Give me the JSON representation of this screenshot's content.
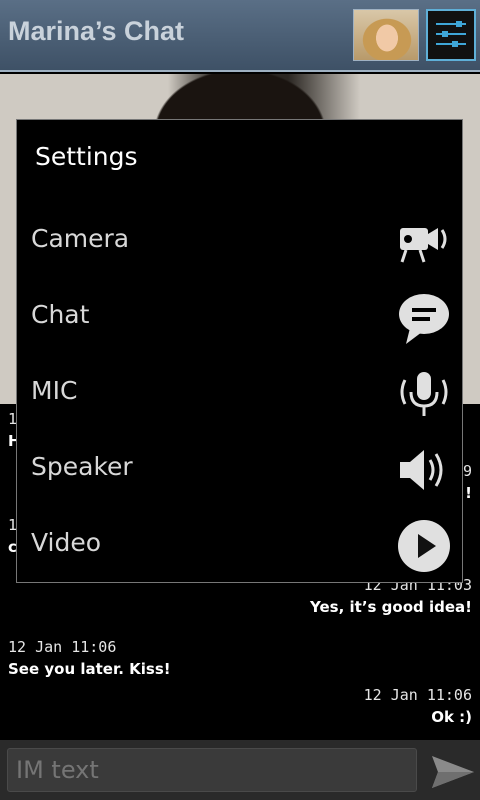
{
  "header": {
    "title": "Marina’s Chat",
    "avatar_icon": "user-avatar",
    "settings_icon": "sliders-icon"
  },
  "messages": [
    {
      "side": "left",
      "time": "1",
      "text": "H"
    },
    {
      "side": "right",
      "time": "9",
      "text": "!"
    },
    {
      "side": "left",
      "time": "1",
      "text": "c"
    },
    {
      "side": "right",
      "time": "12 Jan 11:03",
      "text": "Yes, it’s good idea!"
    },
    {
      "side": "left",
      "time": "12 Jan 11:06",
      "text": "See you later. Kiss!"
    },
    {
      "side": "right",
      "time": "12 Jan 11:06",
      "text": "Ok :)"
    }
  ],
  "input": {
    "placeholder": "IM text"
  },
  "settings": {
    "title": "Settings",
    "items": [
      {
        "label": "Camera",
        "icon": "video-camera-icon"
      },
      {
        "label": "Chat",
        "icon": "chat-bubble-icon"
      },
      {
        "label": "MIC",
        "icon": "microphone-icon"
      },
      {
        "label": "Speaker",
        "icon": "speaker-icon"
      },
      {
        "label": "Video",
        "icon": "play-icon"
      }
    ]
  },
  "colors": {
    "header_bg": "#4a5e74",
    "accent": "#3fa6d8"
  }
}
